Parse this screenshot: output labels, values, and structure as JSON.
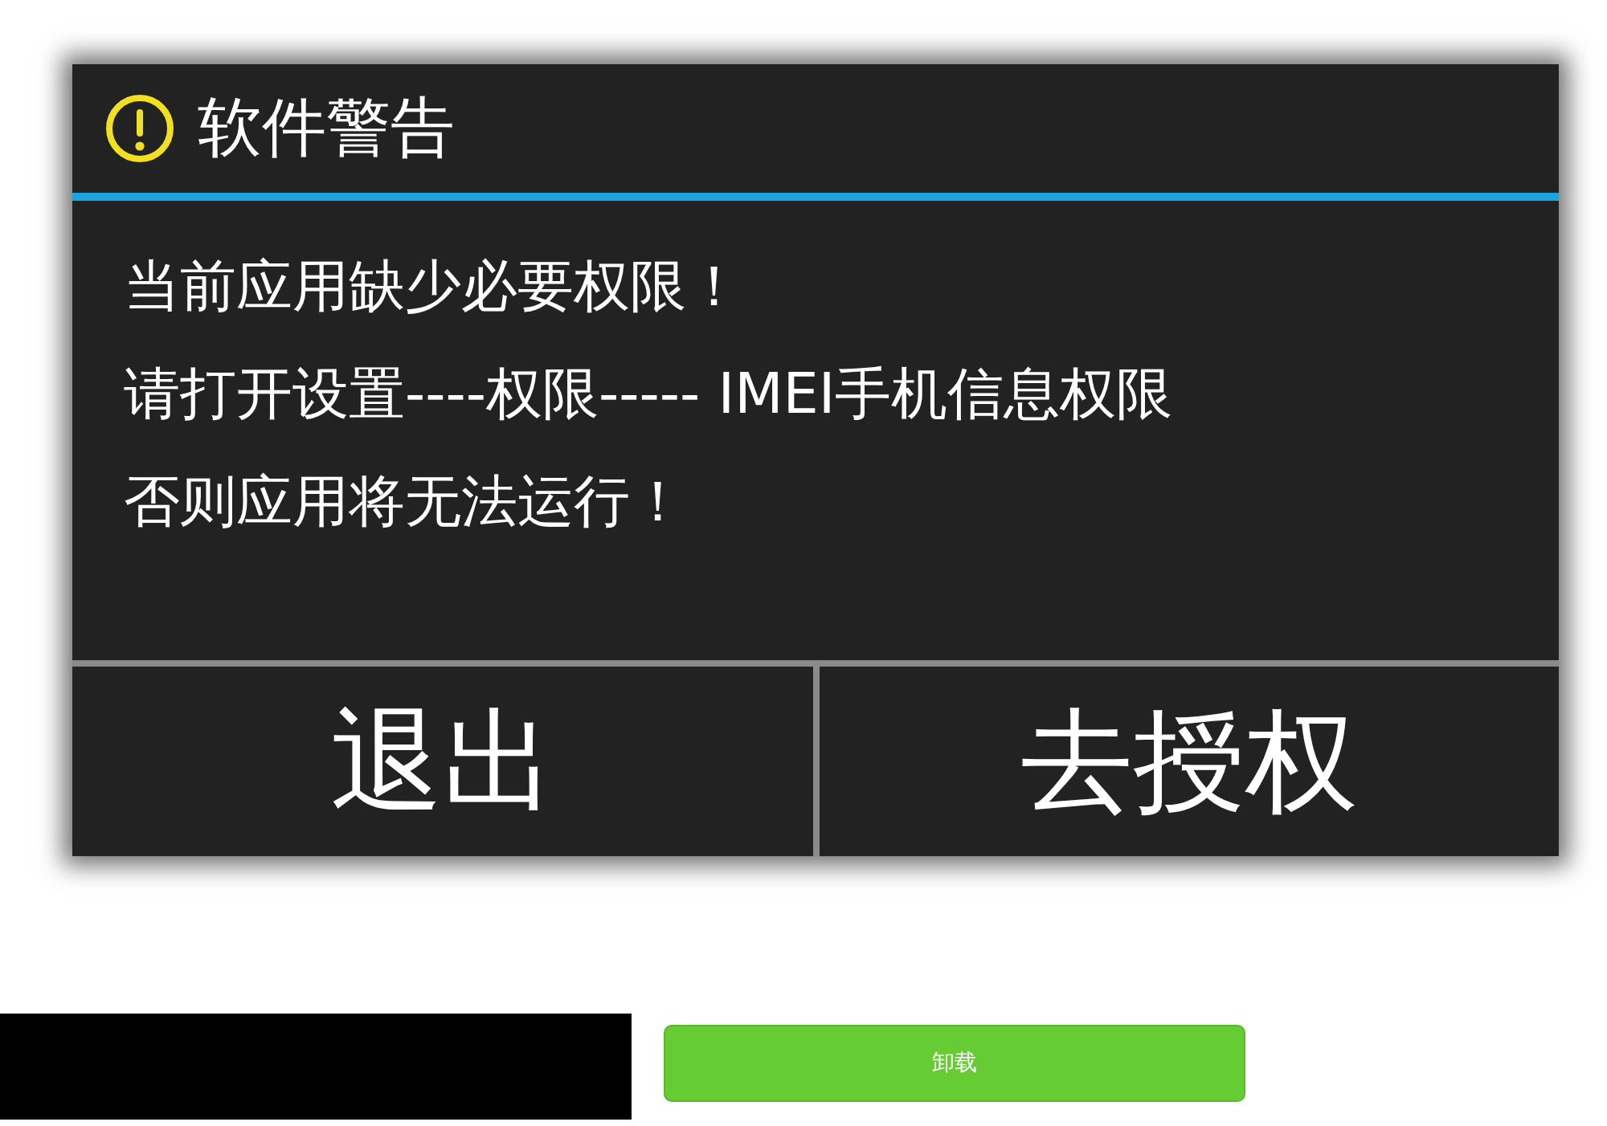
{
  "dialog": {
    "title": "软件警告",
    "message_lines": [
      "当前应用缺少必要权限！",
      "请打开设置----权限----- IMEI手机信息权限",
      "否则应用将无法运行！"
    ],
    "buttons": [
      {
        "label": "退出"
      },
      {
        "label": "去授权"
      }
    ]
  },
  "uninstall_button": {
    "label": "卸载"
  }
}
